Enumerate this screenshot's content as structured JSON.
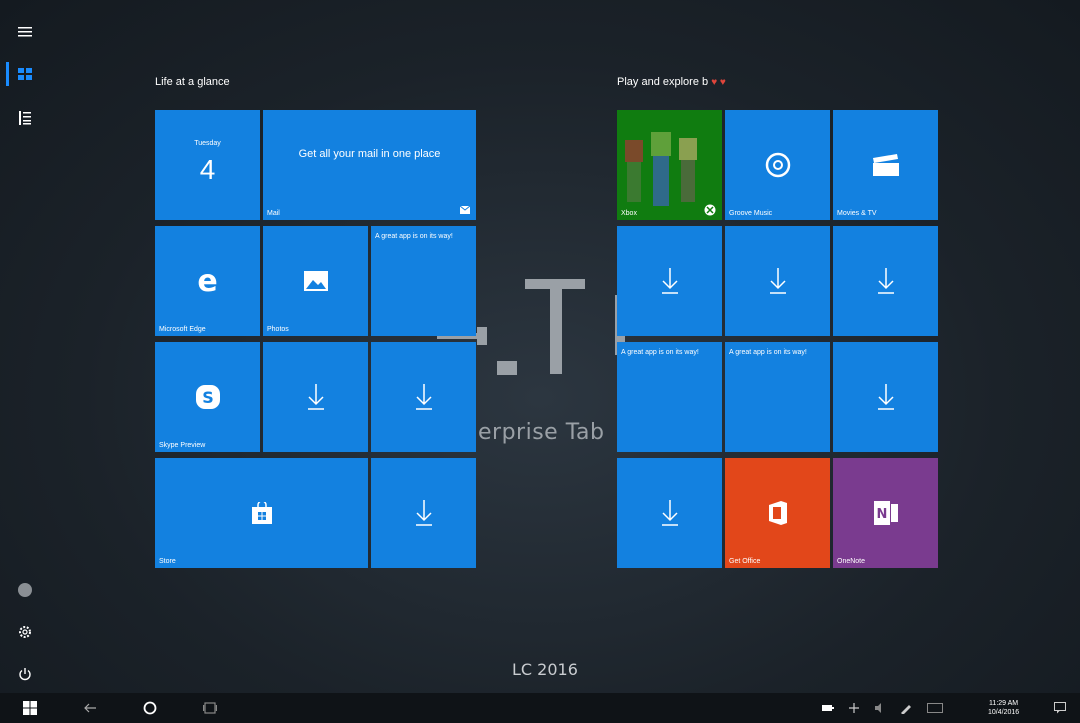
{
  "background": {
    "overlay_text": "erprise Tab",
    "year_text": "LC 2016"
  },
  "rail": {
    "icons": [
      "hamburger-menu-icon",
      "all-tiles-icon",
      "all-apps-list-icon",
      "user-avatar",
      "settings-gear-icon",
      "power-icon"
    ]
  },
  "groups": {
    "left_title": "Life at a glance",
    "right_title": "Play and explore b"
  },
  "tiles": {
    "calendar": {
      "day": "Tuesday",
      "num": "4"
    },
    "mail": {
      "text": "Get all your mail in one place",
      "label": "Mail"
    },
    "edge": {
      "label": "Microsoft Edge"
    },
    "photos": {
      "label": "Photos"
    },
    "placeholder1": {
      "note": "A great app is on its way!"
    },
    "skype": {
      "label": "Skype Preview"
    },
    "store": {
      "label": "Store"
    },
    "xbox": {
      "label": "Xbox"
    },
    "groove": {
      "label": "Groove Music"
    },
    "movies": {
      "label": "Movies & TV"
    },
    "placeholder2": {
      "note": "A great app is on its way!"
    },
    "placeholder3": {
      "note": "A great app is on its way!"
    },
    "office": {
      "label": "Get Office"
    },
    "onenote": {
      "label": "OneNote"
    }
  },
  "taskbar": {
    "time": "11:29 AM",
    "date": "10/4/2016"
  },
  "colors": {
    "tile_blue": "#1381e0",
    "xbox_green": "#107c10",
    "office_orange": "#e2471a",
    "onenote_purple": "#7a3b8f"
  }
}
